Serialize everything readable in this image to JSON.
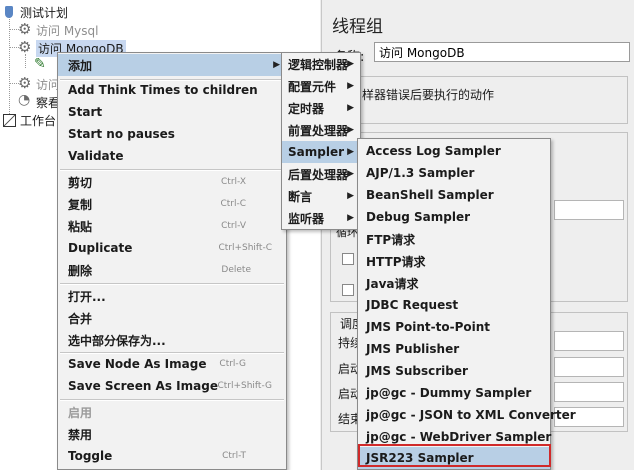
{
  "tree": {
    "test_plan": "测试计划",
    "node_mysql": "访问 Mysql",
    "node_mongodb": "访问 MongoDB",
    "node_third": "访问",
    "node_viewer": "察看",
    "workbench": "工作台"
  },
  "panel": {
    "title": "线程组",
    "name_label": "名称:",
    "name_value": "访问 MongoDB",
    "on_error_label": "样器错误后要执行的动作",
    "frag_loop": "循环",
    "frag_schedule": "调度",
    "frag_duration": "持续",
    "frag_start": "启动",
    "frag_start_delay": "启动",
    "frag_end": "结束"
  },
  "menu_main": {
    "add": "添加",
    "add_think_times": "Add Think Times to children",
    "start": "Start",
    "start_no_pauses": "Start no pauses",
    "validate": "Validate",
    "cut": "剪切",
    "cut_sc": "Ctrl-X",
    "copy": "复制",
    "copy_sc": "Ctrl-C",
    "paste": "粘贴",
    "paste_sc": "Ctrl-V",
    "duplicate": "Duplicate",
    "duplicate_sc": "Ctrl+Shift-C",
    "delete": "删除",
    "delete_sc": "Delete",
    "open": "打开...",
    "merge": "合并",
    "save_selection": "选中部分保存为...",
    "save_node_image": "Save Node As Image",
    "save_node_image_sc": "Ctrl-G",
    "save_screen_image": "Save Screen As Image",
    "save_screen_image_sc": "Ctrl+Shift-G",
    "enable": "启用",
    "disable": "禁用",
    "toggle": "Toggle",
    "toggle_sc": "Ctrl-T"
  },
  "menu_add": {
    "items": [
      "逻辑控制器",
      "配置元件",
      "定时器",
      "前置处理器",
      "Sampler",
      "后置处理器",
      "断言",
      "监听器"
    ]
  },
  "menu_sampler": {
    "items": [
      "Access Log Sampler",
      "AJP/1.3 Sampler",
      "BeanShell Sampler",
      "Debug Sampler",
      "FTP请求",
      "HTTP请求",
      "Java请求",
      "JDBC Request",
      "JMS Point-to-Point",
      "JMS Publisher",
      "JMS Subscriber",
      "jp@gc - Dummy Sampler",
      "jp@gc - JSON to XML Converter",
      "jp@gc - WebDriver Sampler",
      "JSR223 Sampler"
    ]
  },
  "colors": {
    "menu_highlight": "#b8cfe5",
    "callout_border": "#d02a2a"
  },
  "icons": {
    "test_plan": "flask-icon",
    "thread_group": "gear-icon",
    "sampler_node": "pen-icon",
    "listener_node": "ear-icon",
    "workbench": "workbench-icon",
    "submenu": "triangle-right-icon"
  }
}
